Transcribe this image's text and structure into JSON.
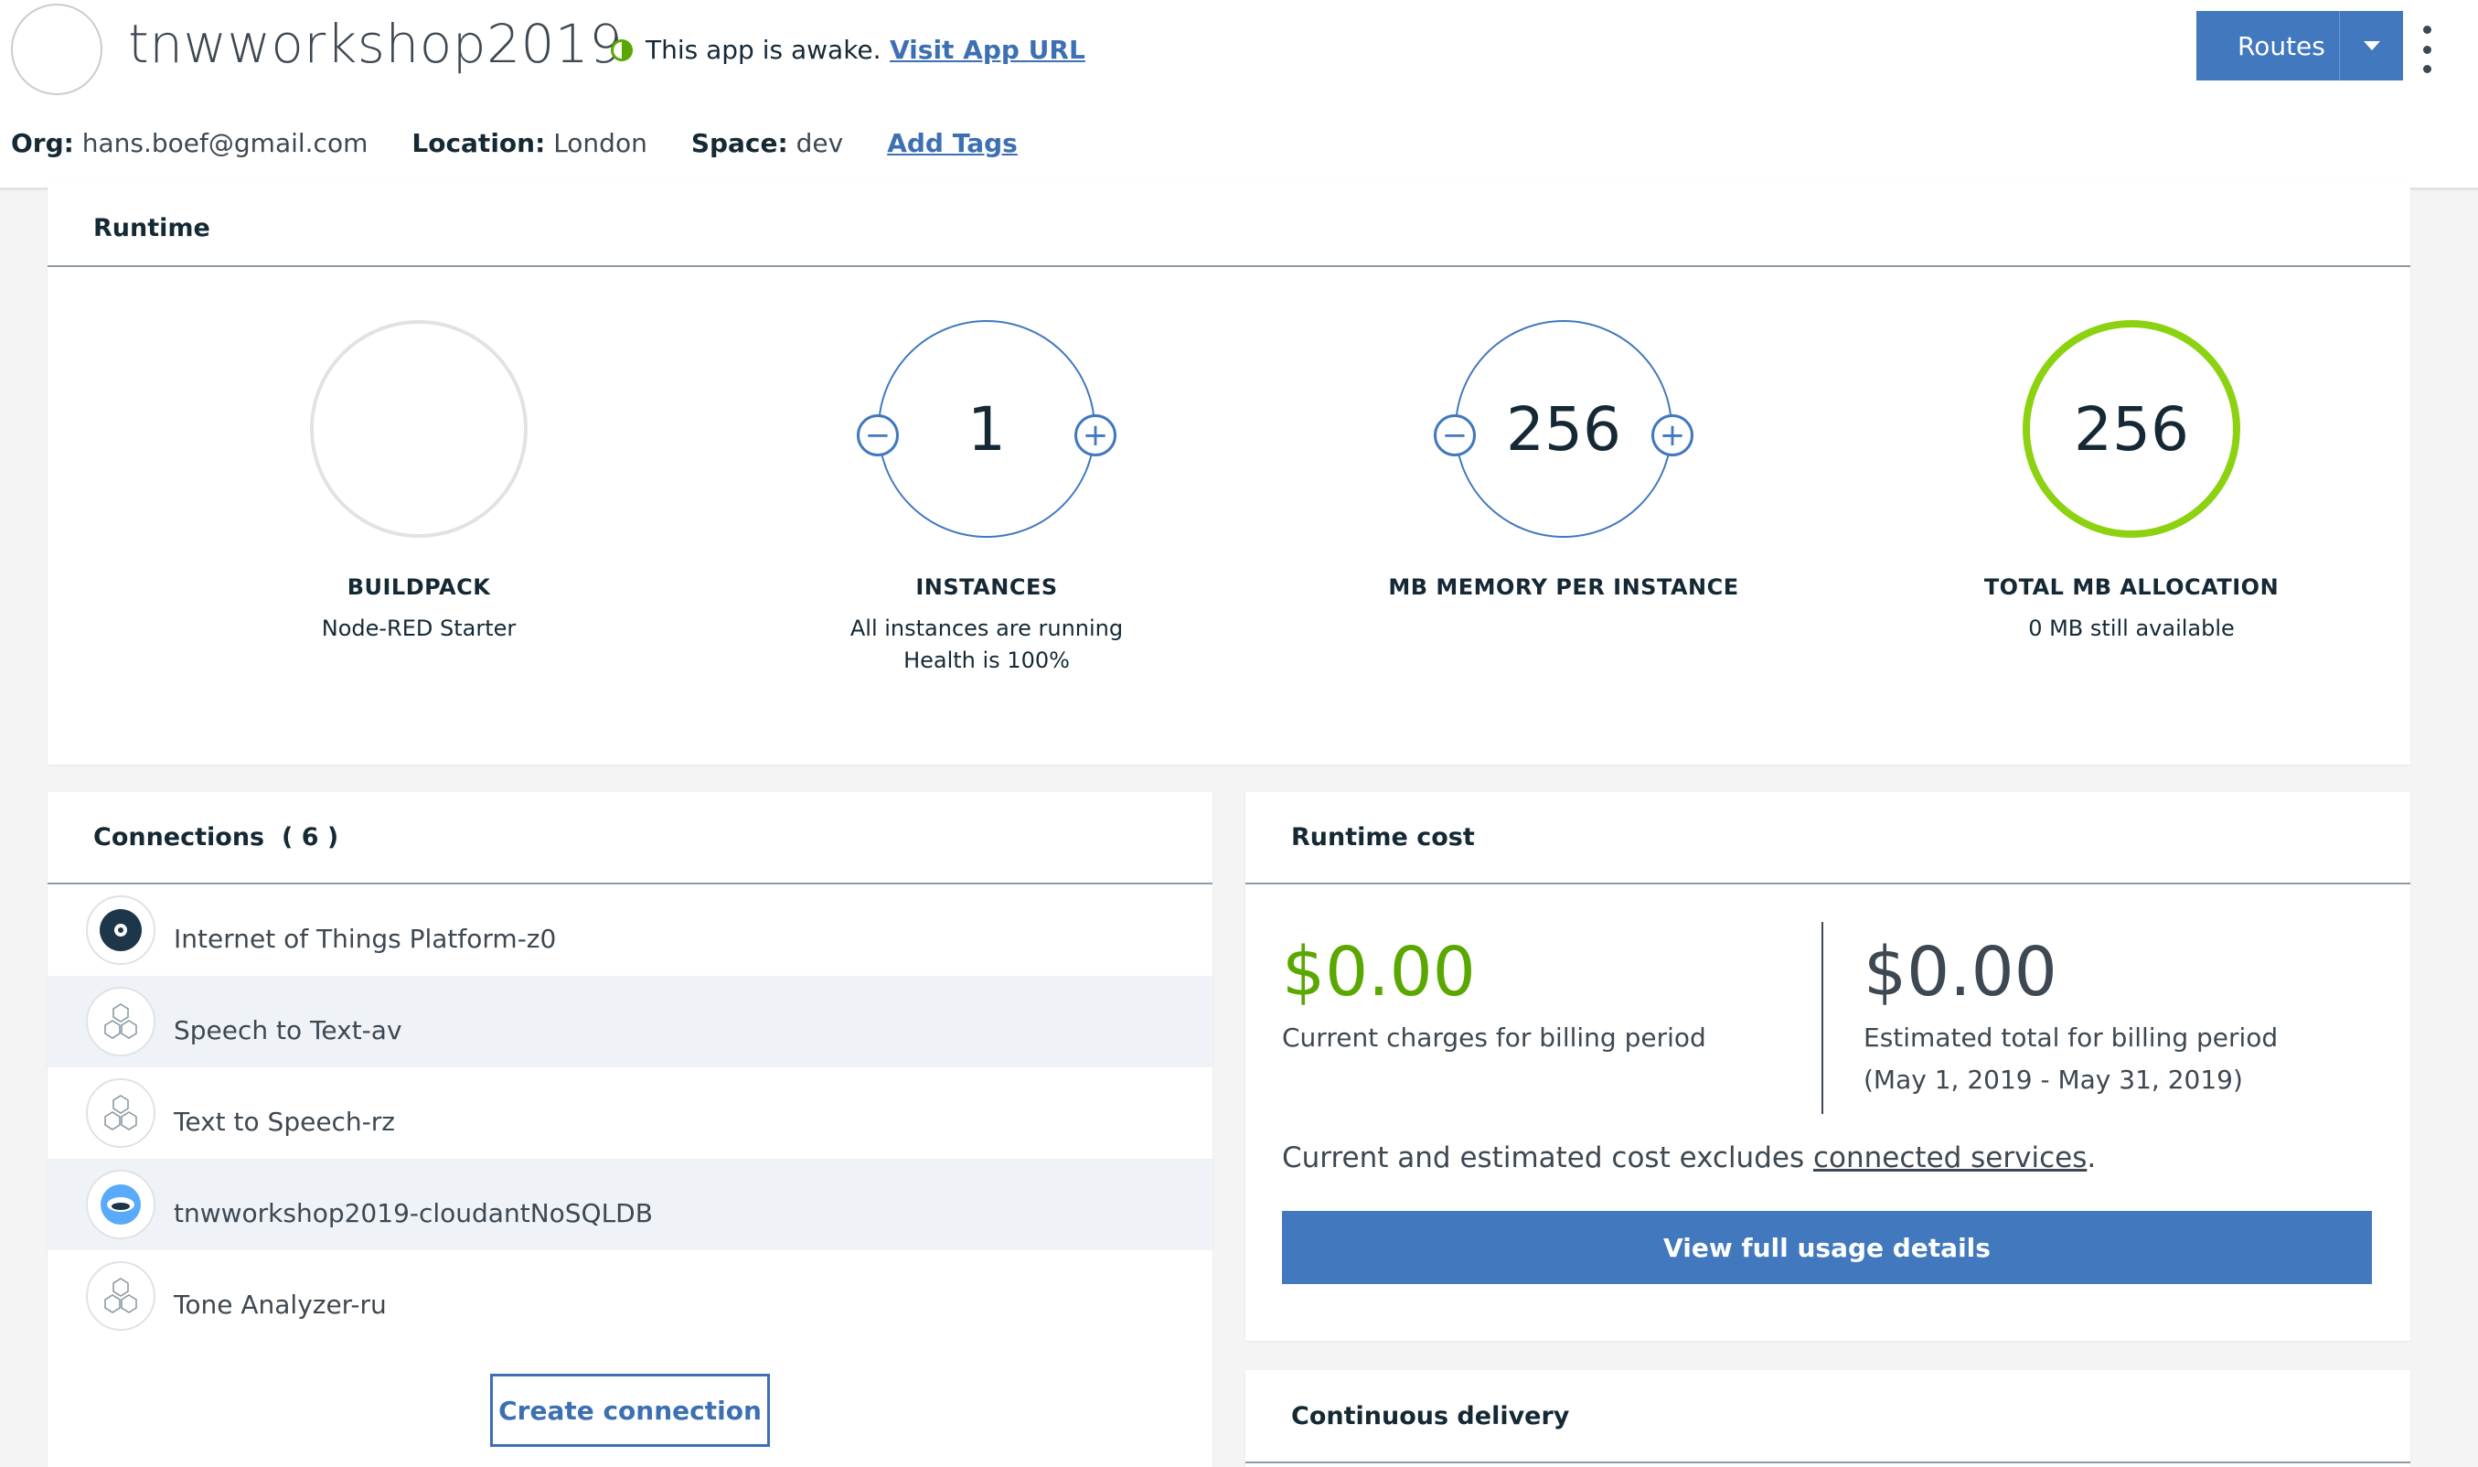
{
  "header": {
    "app_name": "tnwworkshop2019",
    "status_text": "This app is awake.",
    "visit_link": "Visit App URL",
    "routes_label": "Routes",
    "org_label": "Org:",
    "org_value": "hans.boef@gmail.com",
    "location_label": "Location:",
    "location_value": "London",
    "space_label": "Space:",
    "space_value": "dev",
    "add_tags": "Add Tags"
  },
  "runtime": {
    "title": "Runtime",
    "buildpack": {
      "label": "BUILDPACK",
      "sub": "Node-RED Starter"
    },
    "instances": {
      "value": "1",
      "label": "INSTANCES",
      "sub1": "All instances are running",
      "sub2": "Health is 100%"
    },
    "memory": {
      "value": "256",
      "label": "MB MEMORY PER INSTANCE"
    },
    "total": {
      "value": "256",
      "label": "TOTAL MB ALLOCATION",
      "sub": "0 MB still available"
    }
  },
  "connections": {
    "title": "Connections",
    "count": "( 6 )",
    "items": [
      {
        "name": "Internet of Things Platform-z0",
        "icon": "iot-platform-icon"
      },
      {
        "name": "Speech to Text-av",
        "icon": "watson-service-icon"
      },
      {
        "name": "Text to Speech-rz",
        "icon": "watson-service-icon"
      },
      {
        "name": "tnwworkshop2019-cloudantNoSQLDB",
        "icon": "cloudant-icon"
      },
      {
        "name": "Tone Analyzer-ru",
        "icon": "watson-service-icon"
      }
    ],
    "create_button": "Create connection"
  },
  "cost": {
    "title": "Runtime cost",
    "current_amount": "$0.00",
    "current_desc": "Current charges for billing period",
    "estimated_amount": "$0.00",
    "estimated_desc": "Estimated total for billing period",
    "estimated_period": "(May 1, 2019 - May 31, 2019)",
    "note_prefix": "Current and estimated cost excludes ",
    "note_link": "connected services",
    "note_suffix": ".",
    "usage_button": "View full usage details"
  },
  "delivery": {
    "title": "Continuous delivery"
  },
  "colors": {
    "accent": "#4178be",
    "link": "#3d70b2",
    "success": "#5aa700",
    "allocation_ring": "#8cd211"
  }
}
